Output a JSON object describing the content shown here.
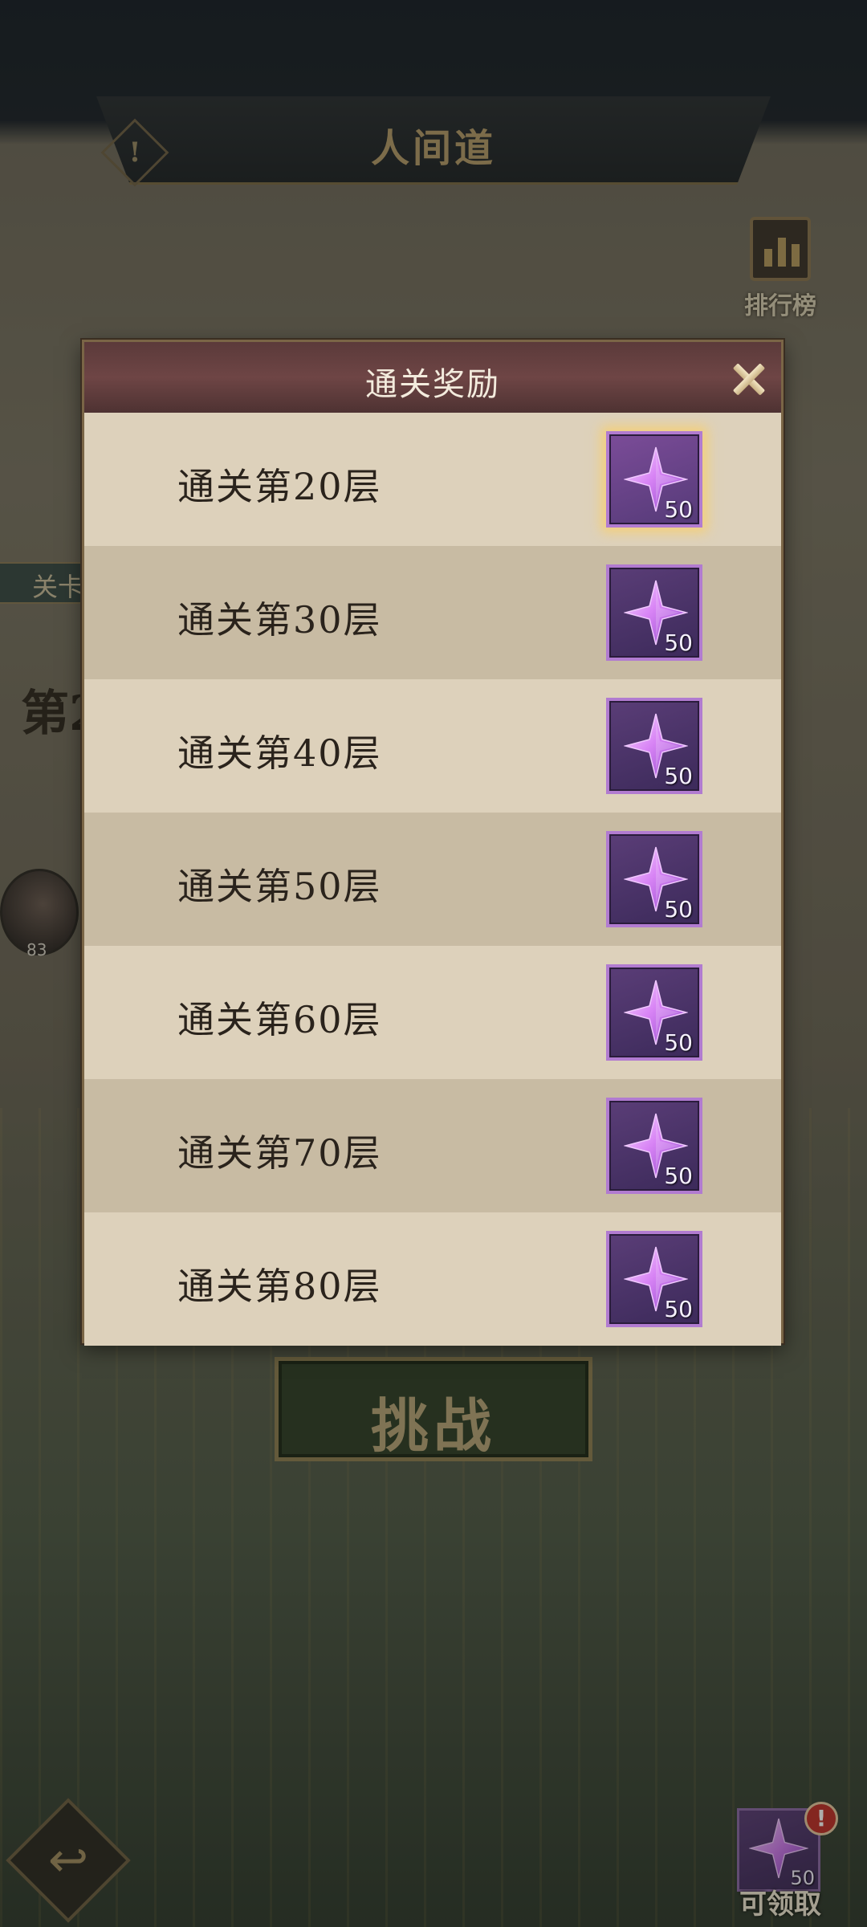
{
  "header": {
    "title": "人间道",
    "info_icon": "info-icon",
    "info_glyph": "!"
  },
  "ranking": {
    "label": "排行榜",
    "icon": "bar-chart-icon"
  },
  "background": {
    "stage_tab": "关卡",
    "floor_text": "第2",
    "avatar_level": "83"
  },
  "modal": {
    "title": "通关奖励",
    "close_icon": "close-icon",
    "rows": [
      {
        "label": "通关第20层",
        "reward_count": "50",
        "highlighted": true
      },
      {
        "label": "通关第30层",
        "reward_count": "50",
        "highlighted": false
      },
      {
        "label": "通关第40层",
        "reward_count": "50",
        "highlighted": false
      },
      {
        "label": "通关第50层",
        "reward_count": "50",
        "highlighted": false
      },
      {
        "label": "通关第60层",
        "reward_count": "50",
        "highlighted": false
      },
      {
        "label": "通关第70层",
        "reward_count": "50",
        "highlighted": false
      },
      {
        "label": "通关第80层",
        "reward_count": "50",
        "highlighted": false
      }
    ],
    "reward_icon": "purple-star-gem-icon"
  },
  "challenge_button": {
    "label": "挑战"
  },
  "back_button": {
    "icon": "back-arrow-icon",
    "glyph": "↩"
  },
  "claimable": {
    "label": "可领取",
    "count": "50",
    "badge": "!",
    "icon": "purple-star-gem-icon"
  },
  "colors": {
    "modal_header": "#5b3a3a",
    "modal_body": "#e1d6c2",
    "row_alt": "#c8bba3",
    "item_border": "#b17bd0",
    "highlight_glow": "#f4d07a"
  }
}
